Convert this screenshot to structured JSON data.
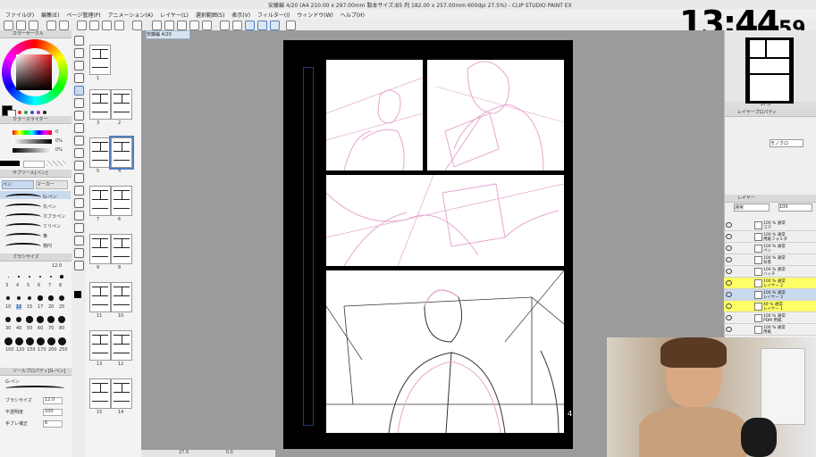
{
  "window": {
    "title": "安藤編 4/20 (A4 210.00 x 297.00mm 製本サイズ:B5 判 182.00 x 257.00mm 600dpi 27.5%) - CLIP STUDIO PAINT EX"
  },
  "menu": [
    "ファイル(F)",
    "編集(E)",
    "ページ管理(P)",
    "アニメーション(A)",
    "レイヤー(L)",
    "選択範囲(S)",
    "表示(V)",
    "フィルター(I)",
    "ウィンドウ(W)",
    "ヘルプ(H)"
  ],
  "clock": {
    "hm": "13:44",
    "s": "59"
  },
  "panels": {
    "color_wheel": "カラーサークル",
    "color_slider": "カラースライダー",
    "sub_tool": "サブツール[ペン]",
    "pen_tab": "ペン",
    "marker_tab": "マーカー",
    "brush_size": "ブラシサイズ",
    "tool_property": "ツールプロパティ[G-ペン]",
    "navigator": "ナビゲーター",
    "layer_property": "レイヤープロパティ",
    "layer": "レイヤー"
  },
  "slider_values": [
    "0",
    "0%",
    "0%"
  ],
  "brushes": [
    "G-ペン",
    "丸ペン",
    "カブラペン",
    "ミリペン",
    "筆",
    "楕円"
  ],
  "sizes": [
    "3",
    "4",
    "5",
    "6",
    "7",
    "8",
    "10",
    "12",
    "15",
    "17",
    "20",
    "25",
    "30",
    "40",
    "50",
    "60",
    "70",
    "80",
    "100",
    "120",
    "150",
    "170",
    "200",
    "250"
  ],
  "selected_size": "12.0",
  "tool_property": {
    "name": "G-ペン",
    "size_label": "ブラシサイズ",
    "size_value": "12.0",
    "opacity_label": "不透明度",
    "opacity_value": "100",
    "stabilize_label": "手ブレ補正",
    "stabilize_value": "6"
  },
  "canvas_tab": "安藤編 4/20",
  "pages": [
    {
      "label": "1"
    },
    {
      "label": "3"
    },
    {
      "label": "2"
    },
    {
      "label": "5"
    },
    {
      "label": "4"
    },
    {
      "label": "7"
    },
    {
      "label": "6"
    },
    {
      "label": "9"
    },
    {
      "label": "8"
    },
    {
      "label": "11"
    },
    {
      "label": "10"
    },
    {
      "label": "13"
    },
    {
      "label": "12"
    },
    {
      "label": "15"
    },
    {
      "label": "14"
    }
  ],
  "page_number_on_canvas": "4",
  "navigator_zoom": "27.5",
  "layer_blend": "通常",
  "layer_opacity": "100",
  "layer_color": "モノクロ",
  "layers": [
    {
      "line1": "100 % 通常",
      "line2": "コマ"
    },
    {
      "line1": "100 % 通常",
      "line2": "用紙フォルダ"
    },
    {
      "line1": "100 % 通常",
      "line2": "ペン"
    },
    {
      "line1": "100 % 通常",
      "line2": "背景"
    },
    {
      "line1": "100 % 通常",
      "line2": "ハッチ"
    },
    {
      "line1": "100 % 通常",
      "line2": "レイヤー 2"
    },
    {
      "line1": "100 % 通常",
      "line2": "レイヤー 2"
    },
    {
      "line1": "49 % 通常",
      "line2": "レイヤー 1"
    },
    {
      "line1": "100 % 通常",
      "line2": "PDM 用紙"
    },
    {
      "line1": "100 % 通常",
      "line2": "用紙"
    }
  ],
  "status": {
    "zoom": "27.5",
    "angle": "0.0"
  },
  "colors": {
    "accent": "#4f7fc1",
    "sketch_pink": "#e6a6cf",
    "layer_highlight": "#ffff66"
  }
}
